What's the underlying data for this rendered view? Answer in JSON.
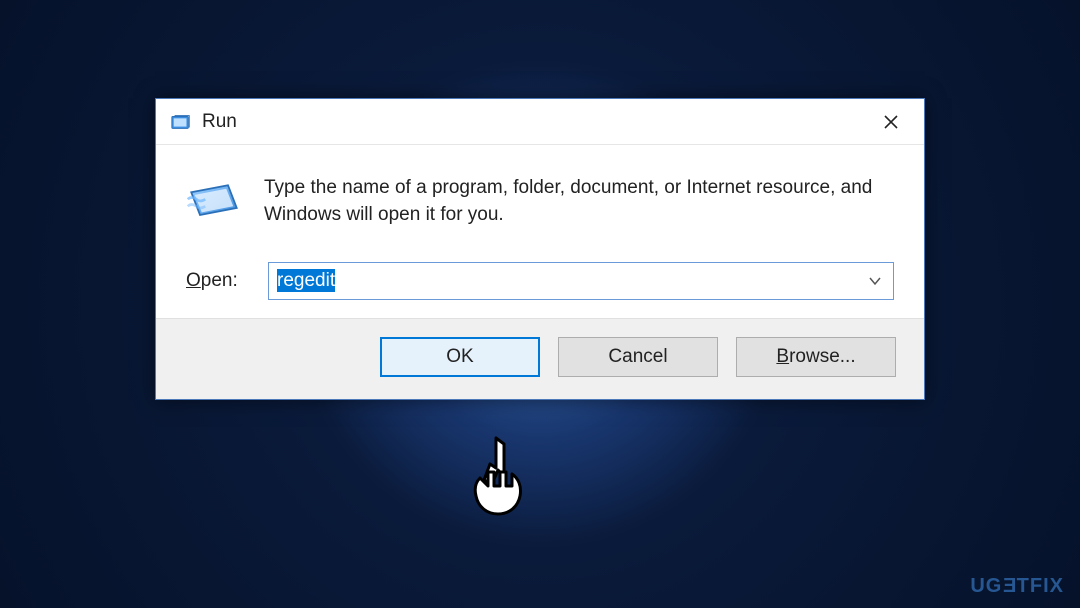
{
  "dialog": {
    "title": "Run",
    "instruction": "Type the name of a program, folder, document, or Internet resource, and Windows will open it for you.",
    "open_label_prefix": "O",
    "open_label_rest": "pen:",
    "input_value": "regedit",
    "buttons": {
      "ok": "OK",
      "cancel": "Cancel",
      "browse_prefix": "B",
      "browse_rest": "rowse..."
    }
  },
  "watermark": "UG",
  "watermark2": "TFIX"
}
